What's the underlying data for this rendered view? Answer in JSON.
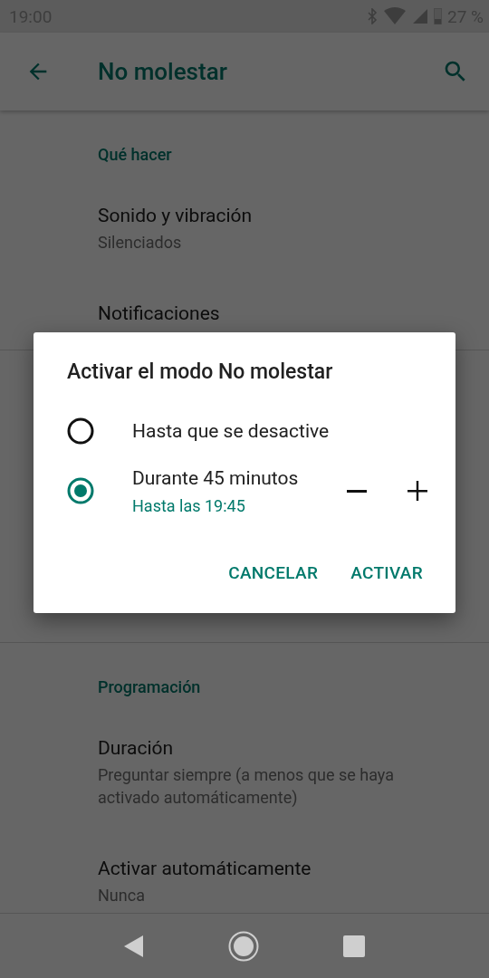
{
  "status_bar": {
    "time": "19:00",
    "battery": "27 %"
  },
  "app_bar": {
    "title": "No molestar"
  },
  "sections": [
    {
      "header": "Qué hacer",
      "items": [
        {
          "title": "Sonido y vibración",
          "subtitle": "Silenciados"
        },
        {
          "title": "Notificaciones"
        }
      ]
    },
    {
      "header": "Programación",
      "items": [
        {
          "title": "Duración",
          "subtitle": "Preguntar siempre (a menos que se haya activado automáticamente)"
        },
        {
          "title": "Activar automáticamente",
          "subtitle": "Nunca"
        }
      ]
    }
  ],
  "dialog": {
    "title": "Activar el modo No molestar",
    "options": [
      {
        "kind": "plain",
        "label": "Hasta que se desactive",
        "selected": false
      },
      {
        "kind": "duration",
        "label": "Durante 45 minutos",
        "subtitle": "Hasta las 19:45",
        "selected": true
      }
    ],
    "buttons": [
      "CANCELAR",
      "ACTIVAR"
    ]
  }
}
